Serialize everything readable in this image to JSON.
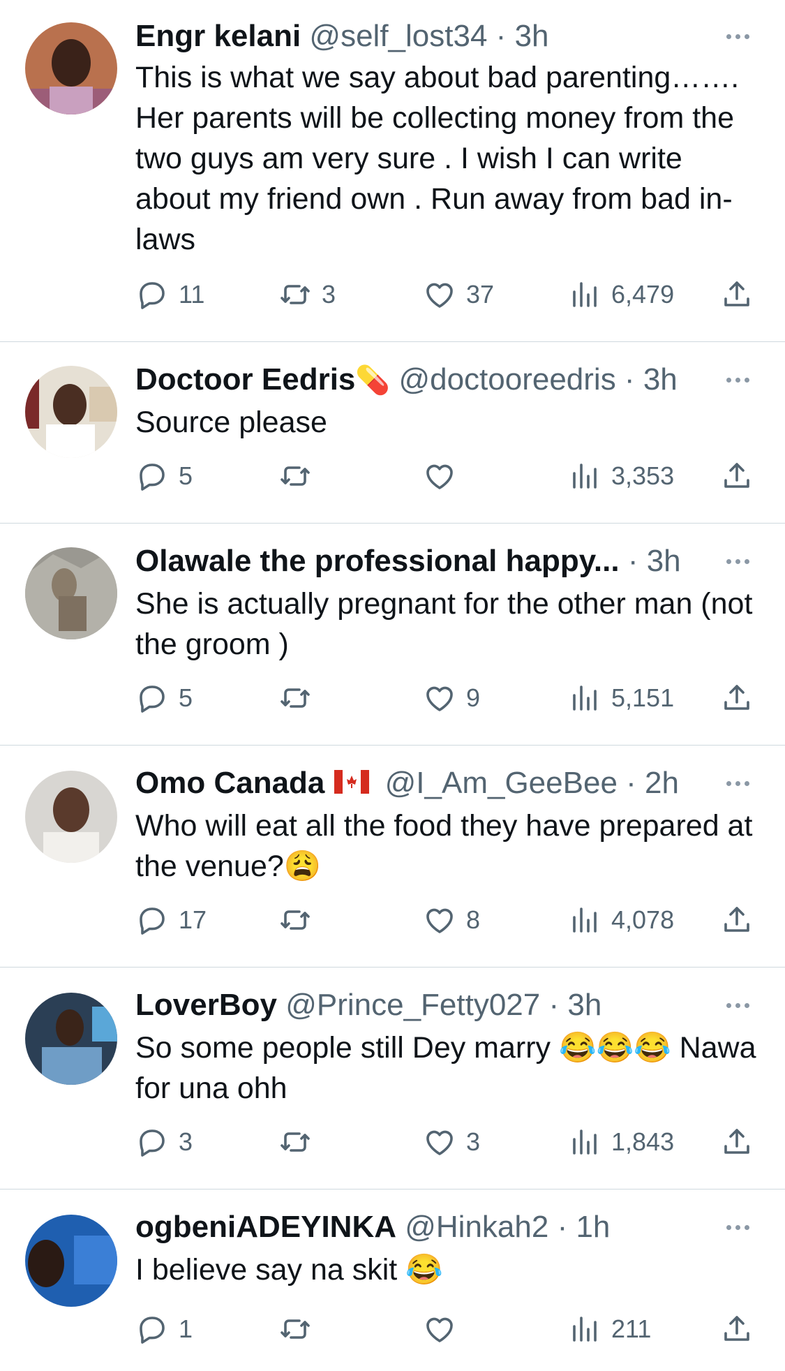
{
  "tweets": [
    {
      "name": "Engr kelani",
      "badge": "",
      "handle": "@self_lost34",
      "time": "3h",
      "text": "This is what we say about bad parenting……. Her parents will be collecting money from the two guys am very sure . I wish I can write about my friend own . Run away from bad in-laws",
      "replies": "11",
      "retweets": "3",
      "likes": "37",
      "views": "6,479"
    },
    {
      "name": "Doctoor Eedris",
      "badge": "💊",
      "handle": "@doctooreedris",
      "time": "3h",
      "text": "Source please",
      "replies": "5",
      "retweets": "",
      "likes": "",
      "views": "3,353"
    },
    {
      "name": "Olawale the professional happy...",
      "badge": "",
      "handle": "",
      "time": "3h",
      "text": "She is actually pregnant for the other man (not the groom )",
      "replies": "5",
      "retweets": "",
      "likes": "9",
      "views": "5,151"
    },
    {
      "name": "Omo Canada",
      "badge": "",
      "handle": "@I_Am_GeeBee",
      "time": "2h",
      "text": "Who will eat all the food they have prepared at the venue?😩",
      "replies": "17",
      "retweets": "",
      "likes": "8",
      "views": "4,078"
    },
    {
      "name": "LoverBoy",
      "badge": "",
      "handle": "@Prince_Fetty027",
      "time": "3h",
      "text": "So some people still Dey marry 😂😂😂 Nawa for una ohh",
      "replies": "3",
      "retweets": "",
      "likes": "3",
      "views": "1,843"
    },
    {
      "name": "ogbeniADEYINKA",
      "badge": "",
      "handle": "@Hinkah2",
      "time": "1h",
      "text": "I believe say na skit 😂",
      "replies": "1",
      "retweets": "",
      "likes": "",
      "views": "211"
    }
  ],
  "colors": {
    "text": "#0f1419",
    "secondary": "#536471",
    "divider": "#cfd9de"
  },
  "icons": [
    "reply-icon",
    "retweet-icon",
    "like-icon",
    "views-icon",
    "share-icon",
    "more-icon"
  ]
}
